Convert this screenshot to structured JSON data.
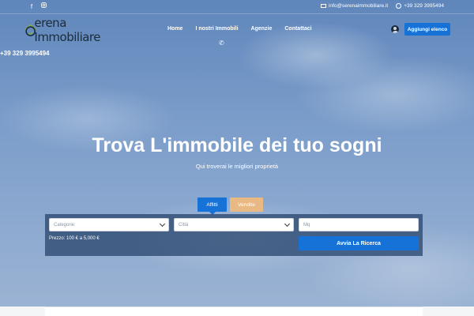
{
  "topbar": {
    "email": "info@serenaimmobiliare.it",
    "phone": "+39 329 3995494",
    "social": [
      "facebook-icon",
      "instagram-icon"
    ]
  },
  "header": {
    "logo_text": "erena Immobiliare",
    "nav": [
      "Home",
      "I nostri Immobili",
      "Agenzie",
      "Contattaci"
    ],
    "add_button": "Aggiungi elenco"
  },
  "phone_left": "+39 329 3995494",
  "hero": {
    "title": "Trova L'immobile dei tuo sogni",
    "subtitle": "Qui troverai le migliori proprietà"
  },
  "search": {
    "tabs": [
      "Affitti",
      "Vendite"
    ],
    "active_tab": "Affitti",
    "category_placeholder": "Categorie:",
    "city_placeholder": "Città",
    "mq_placeholder": "Mq",
    "price_label": "Prezzo: 100 € a 5,000 €",
    "button": "Avvia La Ricerca"
  },
  "colors": {
    "accent": "#1672d6",
    "tab_inactive": "#e9b984",
    "logo_green": "#7fb236"
  }
}
